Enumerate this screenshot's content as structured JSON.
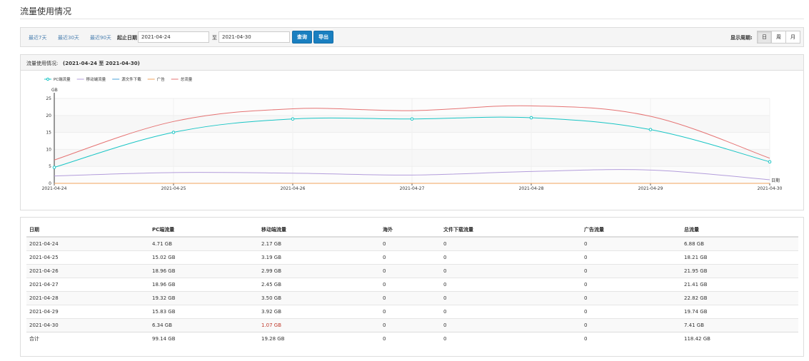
{
  "page": {
    "title": "流量使用情况"
  },
  "toolbar": {
    "quick_ranges": [
      "最近7天",
      "最近30天",
      "最近90天"
    ],
    "start_label": "起止日期",
    "start_value": "2021-04-24",
    "to_label": "至",
    "end_value": "2021-04-30",
    "query_label": "查询",
    "export_label": "导出",
    "period_label": "显示周期:",
    "periods": [
      "日",
      "周",
      "月"
    ],
    "active_period": "日"
  },
  "chart_panel": {
    "label": "流量使用情况:",
    "range": "(2021-04-24 至 2021-04-30)"
  },
  "colors": {
    "pc": "#19c5c5",
    "mobile": "#b39ddb",
    "file": "#4aa3d8",
    "ad": "#f0a35e",
    "total": "#e57373"
  },
  "chart_data": {
    "type": "line",
    "x": [
      "2021-04-24",
      "2021-04-25",
      "2021-04-26",
      "2021-04-27",
      "2021-04-28",
      "2021-04-29",
      "2021-04-30"
    ],
    "ylabel": "GB",
    "xlabel": "日期",
    "ylim": [
      0,
      25
    ],
    "yticks": [
      0,
      5,
      10,
      15,
      20,
      25
    ],
    "grid": true,
    "legend_position": "top-left",
    "series": [
      {
        "key": "pc",
        "name": "PC端流量",
        "values": [
          4.71,
          15.02,
          18.96,
          18.96,
          19.32,
          15.83,
          6.34
        ],
        "markers": true
      },
      {
        "key": "mobile",
        "name": "移动端流量",
        "values": [
          2.17,
          3.19,
          2.99,
          2.45,
          3.5,
          3.92,
          1.07
        ],
        "markers": false
      },
      {
        "key": "file",
        "name": "源文件下载",
        "values": [
          0,
          0,
          0,
          0,
          0,
          0,
          0
        ],
        "markers": false
      },
      {
        "key": "ad",
        "name": "广告",
        "values": [
          0,
          0,
          0,
          0,
          0,
          0,
          0
        ],
        "markers": false
      },
      {
        "key": "total",
        "name": "总流量",
        "values": [
          6.88,
          18.21,
          21.95,
          21.41,
          22.82,
          19.74,
          7.41
        ],
        "markers": false
      }
    ]
  },
  "table": {
    "headers": [
      "日期",
      "PC端流量",
      "移动端流量",
      "海外",
      "文件下载流量",
      "广告流量",
      "总流量"
    ],
    "rows": [
      [
        "2021-04-24",
        "4.71 GB",
        "2.17 GB",
        "0",
        "0",
        "0",
        "6.88 GB"
      ],
      [
        "2021-04-25",
        "15.02 GB",
        "3.19 GB",
        "0",
        "0",
        "0",
        "18.21 GB"
      ],
      [
        "2021-04-26",
        "18.96 GB",
        "2.99 GB",
        "0",
        "0",
        "0",
        "21.95 GB"
      ],
      [
        "2021-04-27",
        "18.96 GB",
        "2.45 GB",
        "0",
        "0",
        "0",
        "21.41 GB"
      ],
      [
        "2021-04-28",
        "19.32 GB",
        "3.50 GB",
        "0",
        "0",
        "0",
        "22.82 GB"
      ],
      [
        "2021-04-29",
        "15.83 GB",
        "3.92 GB",
        "0",
        "0",
        "0",
        "19.74 GB"
      ],
      [
        "2021-04-30",
        "6.34 GB",
        "1.07 GB",
        "0",
        "0",
        "0",
        "7.41 GB"
      ]
    ],
    "totals": [
      "合计",
      "99.14 GB",
      "19.28 GB",
      "0",
      "0",
      "0",
      "118.42 GB"
    ]
  }
}
